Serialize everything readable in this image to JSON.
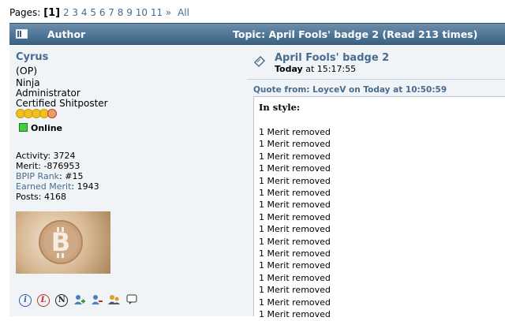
{
  "pagination": {
    "label": "Pages:",
    "current": "[1]",
    "pages": [
      "2",
      "3",
      "4",
      "5",
      "6",
      "7",
      "8",
      "9",
      "10",
      "11"
    ],
    "next": "»",
    "all": "All"
  },
  "header": {
    "author": "Author",
    "topic": "Topic: April Fools' badge 2  (Read 213 times)"
  },
  "poster": {
    "name": "Cyrus",
    "op": "(OP)",
    "rank": "Ninja",
    "group": "Administrator",
    "title": "Certified Shitposter",
    "online": "Online",
    "activity": "Activity: 3724",
    "merit": "Merit: -876953",
    "bpip_label": "BPIP Rank",
    "bpip_value": ": #15",
    "earned_label": "Earned Merit",
    "earned_value": ": 1943",
    "posts": "Posts: 4168"
  },
  "post": {
    "title": "April Fools' badge 2",
    "date_today": "Today",
    "date_time": " at 15:17:55",
    "quote_header": "Quote from: LoyceV on Today at 10:50:59",
    "quote_style": "In style:",
    "merit_lines": [
      "1 Merit removed",
      "1 Merit removed",
      "1 Merit removed",
      "1 Merit removed",
      "1 Merit removed",
      "1 Merit removed",
      "1 Merit removed",
      "1 Merit removed",
      "1 Merit removed",
      "1 Merit removed",
      "1 Merit removed",
      "1 Merit removed",
      "1 Merit removed",
      "1 Merit removed",
      "1 Merit removed",
      "1 Merit removed"
    ]
  },
  "icons": [
    "info-icon",
    "legendary-icon",
    "n-badge-icon",
    "add-buddy-icon",
    "remove-buddy-icon",
    "trust-icon",
    "message-icon"
  ],
  "colors": {
    "header_bg": "#3a6183",
    "link": "#476c8e",
    "panel_bg": "#f0f4f7",
    "online": "#3fcf3f"
  }
}
